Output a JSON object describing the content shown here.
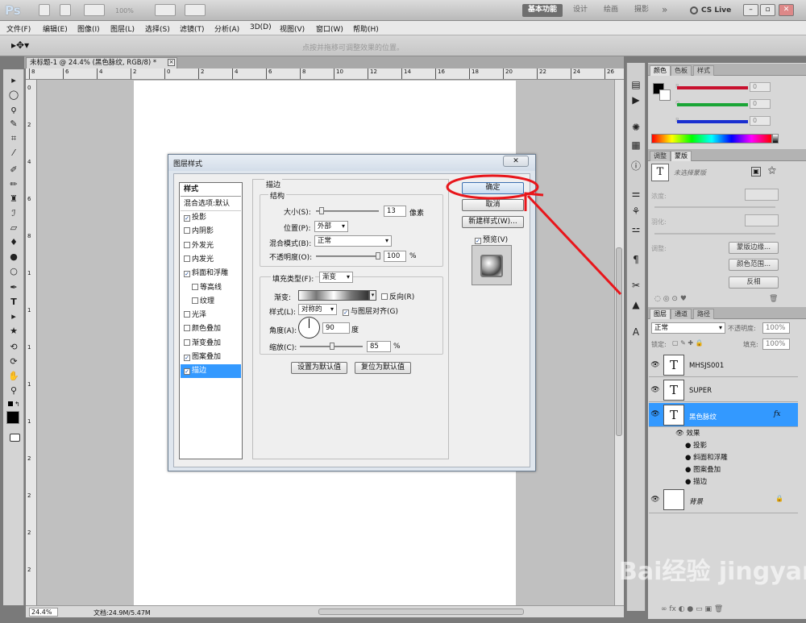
{
  "app": {
    "logo": "Ps",
    "zoom_field": "100%",
    "workspaces": [
      "基本功能",
      "设计",
      "绘画",
      "摄影"
    ],
    "more": "»",
    "cs_live": "CS Live"
  },
  "menu": [
    "文件(F)",
    "编辑(E)",
    "图像(I)",
    "图层(L)",
    "选择(S)",
    "滤镜(T)",
    "分析(A)",
    "3D(D)",
    "视图(V)",
    "窗口(W)",
    "帮助(H)"
  ],
  "options_hint": "点按并拖移可调整效果的位置。",
  "document": {
    "tab": "未标题-1 @ 24.4% (黑色脉纹, RGB/8) *",
    "ruler_h": [
      "8",
      "6",
      "4",
      "2",
      "0",
      "2",
      "4",
      "6",
      "8",
      "10",
      "12",
      "14",
      "16",
      "18",
      "20",
      "22",
      "24",
      "26"
    ],
    "ruler_v": [
      "0",
      "2",
      "4",
      "6",
      "8",
      "1",
      "1",
      "1",
      "1",
      "1",
      "2",
      "2",
      "2",
      "2"
    ],
    "status_zoom": "24.4%",
    "status_doc": "文档:24.9M/5.47M"
  },
  "panels": {
    "color_tabs": [
      "颜色",
      "色板",
      "样式"
    ],
    "color_channels": [
      {
        "name": "R",
        "value": "0"
      },
      {
        "name": "G",
        "value": "0"
      },
      {
        "name": "B",
        "value": "0"
      }
    ],
    "adjust_tabs": [
      "调整",
      "蒙版"
    ],
    "mask_title": "未选择蒙版",
    "density_label": "浓度:",
    "feather_label": "羽化:",
    "refine_label": "调整:",
    "mask_buttons": [
      "蒙版边缘...",
      "颜色范围...",
      "反相"
    ],
    "layers_tabs": [
      "图层",
      "通道",
      "路径"
    ],
    "blend_mode": "正常",
    "opacity_label": "不透明度:",
    "opacity_value": "100%",
    "lock_label": "锁定:",
    "fill_label": "填充:",
    "fill_value": "100%",
    "layers": [
      {
        "name": "MHSJS001",
        "thumb": "T"
      },
      {
        "name": "SUPER",
        "thumb": "T"
      },
      {
        "name": "黑色脉纹",
        "thumb": "T",
        "fx": "fx"
      },
      {
        "name": "背景",
        "thumb": ""
      }
    ],
    "effects_label": "效果",
    "effects": [
      "投影",
      "斜面和浮雕",
      "图案叠加",
      "描边"
    ]
  },
  "dialog": {
    "title": "图层样式",
    "styles_header": "样式",
    "blending": "混合选项:默认",
    "styles": [
      {
        "label": "投影",
        "checked": true
      },
      {
        "label": "内阴影",
        "checked": false
      },
      {
        "label": "外发光",
        "checked": false
      },
      {
        "label": "内发光",
        "checked": false
      },
      {
        "label": "斜面和浮雕",
        "checked": true
      },
      {
        "label": "等高线",
        "checked": false,
        "sub": true
      },
      {
        "label": "纹理",
        "checked": false,
        "sub": true
      },
      {
        "label": "光泽",
        "checked": false
      },
      {
        "label": "颜色叠加",
        "checked": false
      },
      {
        "label": "渐变叠加",
        "checked": false
      },
      {
        "label": "图案叠加",
        "checked": true
      },
      {
        "label": "描边",
        "checked": true,
        "selected": true
      }
    ],
    "section_title": "描边",
    "structure_title": "结构",
    "size_label": "大小(S):",
    "size_value": "13",
    "size_unit": "像素",
    "position_label": "位置(P):",
    "position_value": "外部",
    "blend_label": "混合模式(B):",
    "blend_value": "正常",
    "opacity_label": "不透明度(O):",
    "opacity_value": "100",
    "percent": "%",
    "fill_type_label": "填充类型(F):",
    "fill_type_value": "渐变",
    "gradient_label": "渐变:",
    "reverse_label": "反向(R)",
    "style_label": "样式(L):",
    "style_value": "对称的",
    "align_label": "与图层对齐(G)",
    "angle_label": "角度(A):",
    "angle_value": "90",
    "angle_unit": "度",
    "scale_label": "缩放(C):",
    "scale_value": "85",
    "set_default": "设置为默认值",
    "reset_default": "复位为默认值",
    "ok": "确定",
    "cancel": "取消",
    "new_style": "新建样式(W)...",
    "preview": "预览(V)"
  },
  "watermark": "Bai经验 jingyan.baidu.com",
  "colors": {
    "annotation": "#e8161b",
    "selection": "#3399ff"
  }
}
